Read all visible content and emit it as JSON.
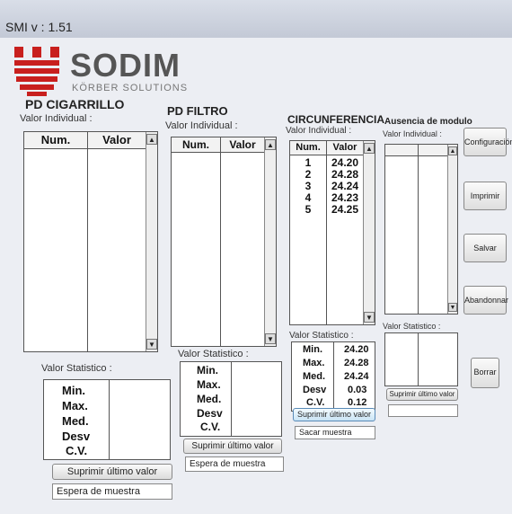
{
  "window": {
    "title": "SMI v : 1.51"
  },
  "brand": {
    "name": "SODIM",
    "subtitle": "KÖRBER SOLUTIONS"
  },
  "cigarrillo": {
    "title": "PD CIGARRILLO",
    "subtitle": "Valor Individual :",
    "col_num": "Num.",
    "col_valor": "Valor",
    "stat_title": "Valor Statistico :",
    "stat_labels": [
      "Min.",
      "Max.",
      "Med.",
      "Desv",
      "C.V."
    ],
    "button": "Suprimir último valor",
    "status": "Espera de muestra"
  },
  "filtro": {
    "title": "PD FILTRO",
    "subtitle": "Valor Individual :",
    "col_num": "Num.",
    "col_valor": "Valor",
    "stat_title": "Valor Statistico :",
    "stat_labels": [
      "Min.",
      "Max.",
      "Med.",
      "Desv",
      "C.V."
    ],
    "button": "Suprimir último valor",
    "status": "Espera de muestra"
  },
  "circunferencia": {
    "title": "CIRCUNFERENCIA",
    "subtitle": "Valor Individual :",
    "col_num": "Num.",
    "col_valor": "Valor",
    "rows": [
      {
        "num": "1",
        "valor": "24.20"
      },
      {
        "num": "2",
        "valor": "24.28"
      },
      {
        "num": "3",
        "valor": "24.24"
      },
      {
        "num": "4",
        "valor": "24.23"
      },
      {
        "num": "5",
        "valor": "24.25"
      }
    ],
    "stat_title": "Valor Statistico :",
    "stat_labels": [
      "Min.",
      "Max.",
      "Med.",
      "Desv",
      "C.V."
    ],
    "stat_values": [
      "24.20",
      "24.28",
      "24.24",
      "0.03",
      "0.12"
    ],
    "button": "Suprimir último valor",
    "status": "Sacar muestra"
  },
  "ausencia": {
    "title": "Ausencia de modulo",
    "subtitle": "Valor Individual :",
    "stat_title": "Valor Statistico :",
    "button": "Suprimir último valor"
  },
  "side_buttons": {
    "config": "Configuración",
    "print": "Imprimir",
    "save": "Salvar",
    "exit": "Abandonnar",
    "clear": "Borrar"
  }
}
